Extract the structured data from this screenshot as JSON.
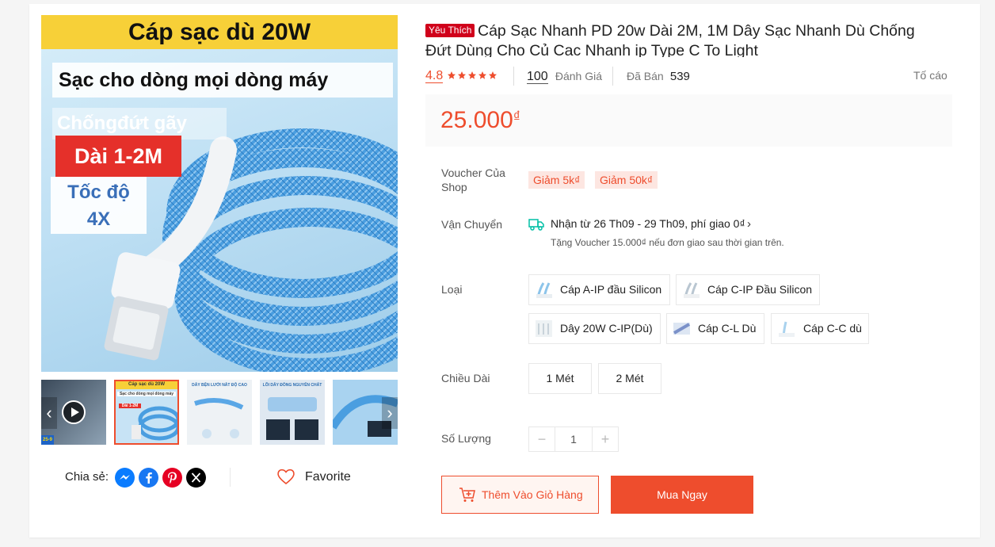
{
  "hero": {
    "top_banner": "Cáp sạc dù 20W",
    "subtitle": "Sạc cho dòng mọi dòng máy",
    "feature_1": "Chốngđứt gãy",
    "feature_2": "Dài 1-2M",
    "feature_3_line1": "Tốc độ",
    "feature_3_line2": "4X"
  },
  "thumbnails": {
    "thumb_2_title": "Cáp sạc dù 20W",
    "thumb_2_sub": "Sạc cho dòng mọi dòng máy",
    "thumb_2_badge": "Dài 1-2M",
    "thumb_3_title": "DÂY BỆN LƯỚI NẮT ĐỘ CAO",
    "thumb_4_title": "LÕI DÂY ĐỒNG NGUYÊN CHẤT",
    "thumb_1_badge": "25-9"
  },
  "share": {
    "label": "Chia sẻ:",
    "icons": [
      "messenger-icon",
      "facebook-icon",
      "pinterest-icon",
      "x-twitter-icon"
    ],
    "favorite_label": "Favorite"
  },
  "product": {
    "badge": "Yêu Thích",
    "title": "Cáp Sạc Nhanh PD 20w Dài 2M, 1M Dây Sạc Nhanh Dù Chống Đứt Dùng Cho Củ Cac Nhanh ip Type C To Light",
    "rating": "4.8",
    "stars": 5,
    "review_count": "100",
    "review_label": "Đánh Giá",
    "sold_label": "Đã Bán",
    "sold_count": "539",
    "report_label": "Tố cáo",
    "price": "25.000",
    "currency": "₫"
  },
  "voucher": {
    "label": "Voucher Của Shop",
    "tags": [
      "Giảm 5k₫",
      "Giảm 50k₫"
    ]
  },
  "shipping": {
    "label": "Vận Chuyển",
    "main": "Nhận từ 26 Th09 - 29 Th09, phí giao 0₫",
    "sub": "Tặng Voucher 15.000₫ nếu đơn giao sau thời gian trên."
  },
  "variants": {
    "label": "Loại",
    "options": [
      "Cáp A-IP đầu Silicon",
      "Cáp C-IP Đầu Silicon",
      "Dây 20W C-IP(Dù)",
      "Cáp C-L Dù",
      "Cáp C-C dù"
    ]
  },
  "length": {
    "label": "Chiều Dài",
    "options": [
      "1 Mét",
      "2 Mét"
    ]
  },
  "quantity": {
    "label": "Số Lượng",
    "value": "1",
    "minus": "−",
    "plus": "+"
  },
  "actions": {
    "add_to_cart": "Thêm Vào Giỏ Hàng",
    "buy_now": "Mua Ngay"
  },
  "colors": {
    "accent": "#ee4d2d",
    "badge_red": "#d0011b",
    "banner_yellow": "#f7d038"
  }
}
